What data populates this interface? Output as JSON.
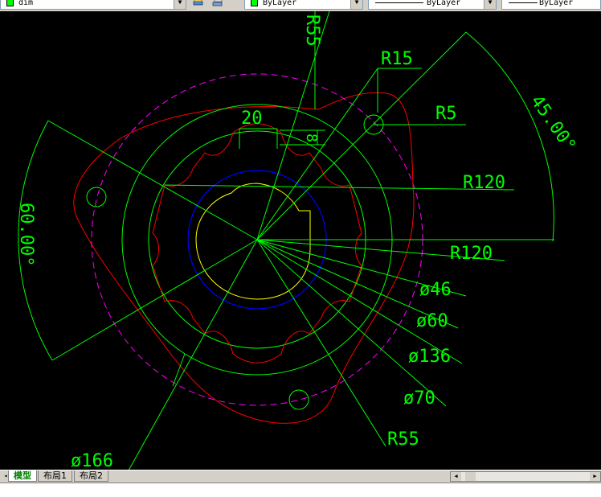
{
  "toolbar": {
    "layer_name": "dim",
    "color_value": "ByLayer",
    "linetype_value": "ByLayer",
    "lineweight_value": "ByLayer",
    "accent": "#00ff00"
  },
  "drawing": {
    "dimensions": {
      "r55_top": "R55",
      "r15": "R15",
      "r5": "R5",
      "angle_45": "45.00°",
      "r120_a": "R120",
      "r120_b": "R120",
      "d46": "ø46",
      "d60": "ø60",
      "d136": "ø136",
      "d70": "ø70",
      "r55_bottom": "R55",
      "d166": "ø166",
      "angle_60": "60.00°",
      "width_20": "20",
      "width_8": "8"
    },
    "colors": {
      "dimension": "#00ff00",
      "outline": "#ff0000",
      "bolt_circle": "#ff00ff",
      "ring": "#0000ff",
      "bore": "#ffff00",
      "background": "#000000"
    }
  },
  "tabs": [
    {
      "label": "模型",
      "active": true
    },
    {
      "label": "布局1",
      "active": false
    },
    {
      "label": "布局2",
      "active": false
    }
  ],
  "command_line": {
    "text": ""
  }
}
